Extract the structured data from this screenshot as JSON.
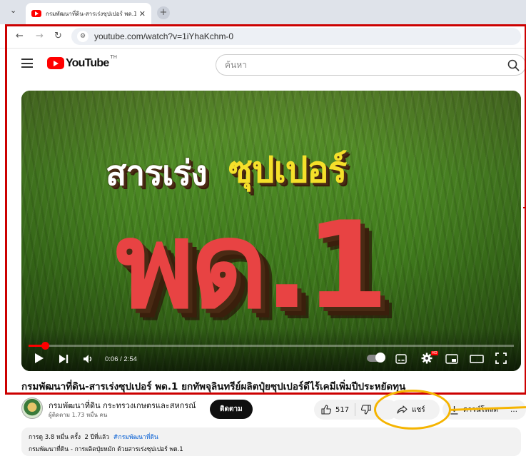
{
  "browser": {
    "tab_title": "กรมพัฒนาที่ดิน-สารเร่งซุปเปอร์ พด.1",
    "tab_close": "✕",
    "new_tab": "+",
    "url": "youtube.com/watch?v=1iYhaKchm-0",
    "back_icon": "arrow-left",
    "forward_icon": "arrow-right",
    "reload_icon": "reload"
  },
  "youtube": {
    "logo_text": "YouTube",
    "logo_country": "TH",
    "search_placeholder": "ค้นหา"
  },
  "player": {
    "thumbnail_line1": "สารเร่ง",
    "thumbnail_line2": "ซุปเปอร์",
    "thumbnail_big": "พด.1",
    "time": "0:06 / 2:54",
    "progress_fraction": 0.034,
    "hd_badge": "HD"
  },
  "video": {
    "title": "กรมพัฒนาที่ดิน-สารเร่งซุปเปอร์ พด.1 ยกทัพจุลินทรีย์ผลิตปุ๋ยซุปเปอร์ดีไร้เคมีเพิ่มปีประหยัดทุน",
    "channel_name": "กรมพัฒนาที่ดิน กระทรวงเกษตรและสหกรณ์",
    "subscribers": "ผู้ติดตาม 1.73 หมื่น คน",
    "subscribe_label": "ติดตาม",
    "like_count": "517",
    "share_label": "แชร์",
    "download_label": "ดาวน์โหลด",
    "more_label": "…"
  },
  "description": {
    "views": "การดู 3.8 หมื่น ครั้ง",
    "age": "2 ปีที่แล้ว",
    "hashtag": "#กรมพัฒนาที่ดิน",
    "text": "กรมพัฒนาที่ดิน - การผลิตปุ๋ยหมัก ด้วยสารเร่งซุปเปอร์ พด.1"
  },
  "annotation_colors": {
    "frame": "#cc0000",
    "highlight": "#f5b400"
  }
}
